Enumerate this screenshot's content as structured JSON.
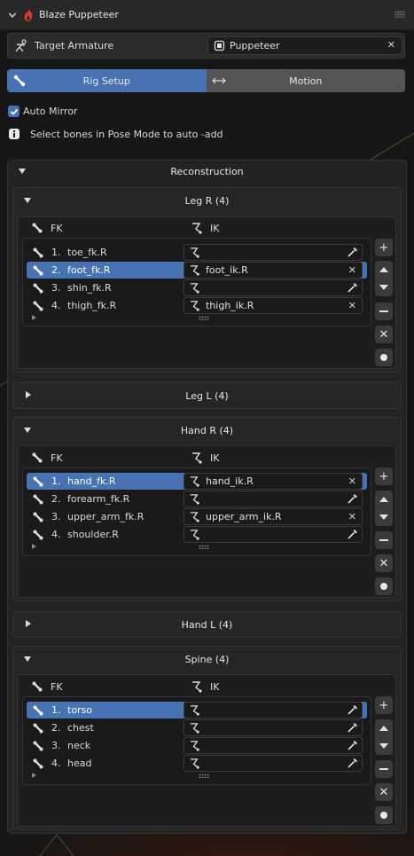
{
  "header": {
    "title": "Blaze Puppeteer"
  },
  "armature": {
    "label": "Target Armature",
    "value": "Puppeteer"
  },
  "tabs": [
    {
      "label": "Rig Setup"
    },
    {
      "label": "Motion"
    }
  ],
  "auto_mirror": {
    "label": "Auto Mirror",
    "checked": true
  },
  "info": {
    "text": "Select bones in Pose Mode to auto -add"
  },
  "reconstruction": {
    "title": "Reconstruction"
  },
  "columns": {
    "fk": "FK",
    "ik": "IK"
  },
  "legR": {
    "title": "Leg R (4)",
    "rows": [
      {
        "num": "1.",
        "fk": "toe_fk.R",
        "ik": ""
      },
      {
        "num": "2.",
        "fk": "foot_fk.R",
        "ik": "foot_ik.R"
      },
      {
        "num": "3.",
        "fk": "shin_fk.R",
        "ik": ""
      },
      {
        "num": "4.",
        "fk": "thigh_fk.R",
        "ik": "thigh_ik.R"
      }
    ]
  },
  "legL": {
    "title": "Leg L (4)"
  },
  "handR": {
    "title": "Hand R (4)",
    "rows": [
      {
        "num": "1.",
        "fk": "hand_fk.R",
        "ik": "hand_ik.R"
      },
      {
        "num": "2.",
        "fk": "forearm_fk.R",
        "ik": ""
      },
      {
        "num": "3.",
        "fk": "upper_arm_fk.R",
        "ik": "upper_arm_ik.R"
      },
      {
        "num": "4.",
        "fk": "shoulder.R",
        "ik": ""
      }
    ]
  },
  "handL": {
    "title": "Hand L (4)"
  },
  "spine": {
    "title": "Spine (4)",
    "rows": [
      {
        "num": "1.",
        "fk": "torso",
        "ik": ""
      },
      {
        "num": "2.",
        "fk": "chest",
        "ik": ""
      },
      {
        "num": "3.",
        "fk": "neck",
        "ik": ""
      },
      {
        "num": "4.",
        "fk": "head",
        "ik": ""
      }
    ]
  },
  "colors": {
    "accent": "#4772b3",
    "panel": "#232323",
    "field": "#1a1a1a"
  }
}
